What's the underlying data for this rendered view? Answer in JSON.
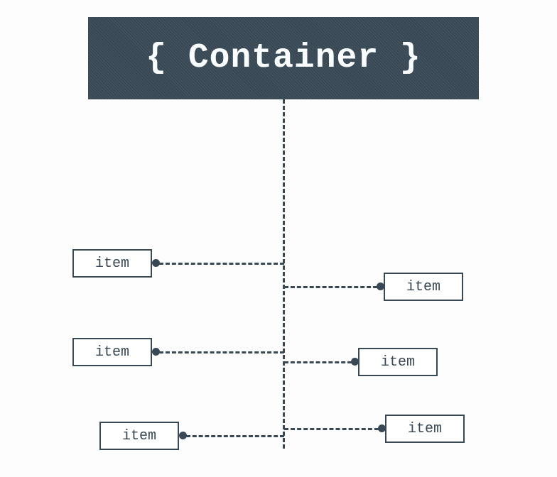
{
  "container": {
    "label_full": "{ Container }"
  },
  "items": {
    "left": [
      {
        "label": "item"
      },
      {
        "label": "item"
      },
      {
        "label": "item"
      }
    ],
    "right": [
      {
        "label": "item"
      },
      {
        "label": "item"
      },
      {
        "label": "item"
      }
    ]
  }
}
